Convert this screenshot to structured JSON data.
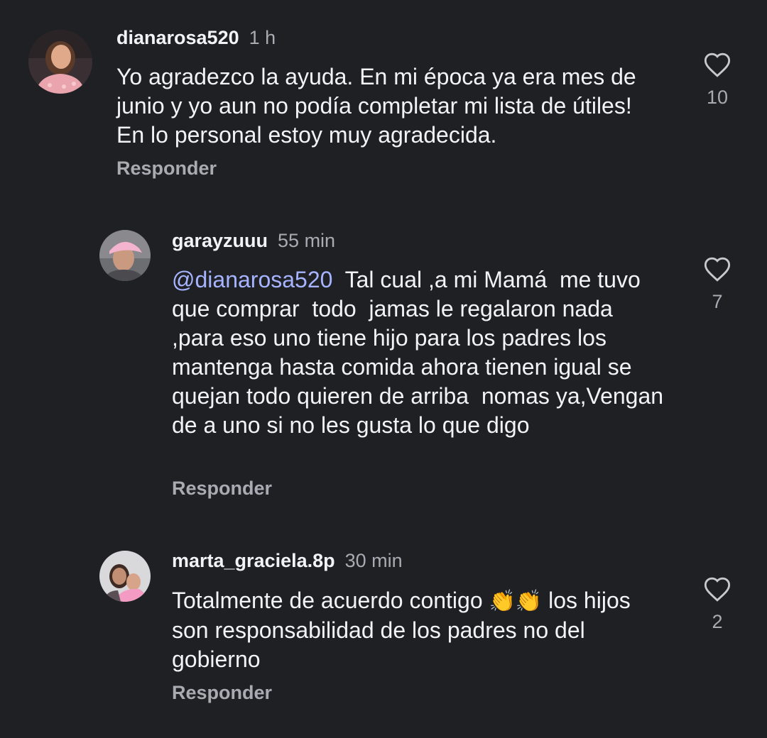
{
  "comments": [
    {
      "username": "dianarosa520",
      "time": "1 h",
      "text": "Yo agradezco la ayuda. En mi época ya era mes de junio y yo aun no podía completar mi lista de útiles! En lo personal estoy muy agradecida.",
      "reply_label": "Responder",
      "likes": "10",
      "avatar_icon": "avatar-woman-pink-dress"
    },
    {
      "username": "garayzuuu",
      "time": "55 min",
      "mention": "@dianarosa520",
      "text": "  Tal cual ,a mi Mamá  me tuvo que comprar  todo  jamas le regalaron nada ,para eso uno tiene hijo para los padres los mantenga hasta comida ahora tienen igual se quejan todo quieren de arriba  nomas ya,Vengan de a uno si no les gusta lo que digo",
      "reply_label": "Responder",
      "likes": "7",
      "avatar_icon": "avatar-woman-pink-cap"
    },
    {
      "username": "marta_graciela.8p",
      "time": "30 min",
      "text_before": "Totalmente de acuerdo contigo ",
      "emoji": "👏👏",
      "text_after": " los hijos son responsabilidad de los padres no del gobierno",
      "reply_label": "Responder",
      "likes": "2",
      "avatar_icon": "avatar-woman-and-child"
    }
  ],
  "colors": {
    "background": "#1f2024",
    "primary_text": "#f2f3f5",
    "secondary_text": "#a8abb2",
    "mention": "#a6b4ff"
  }
}
